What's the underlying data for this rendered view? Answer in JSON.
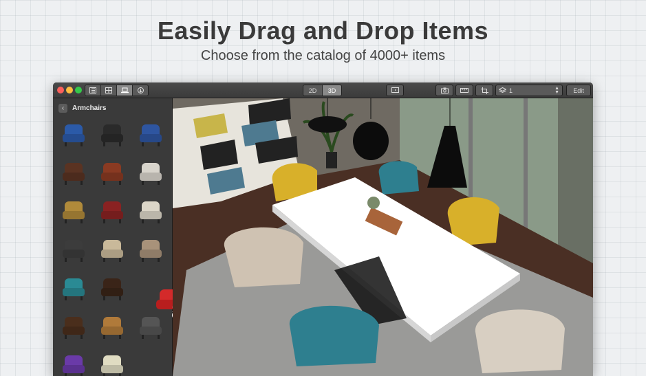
{
  "headline": "Easily Drag and Drop Items",
  "subline": "Choose from the catalog of 4000+ items",
  "toolbar": {
    "view_2d": "2D",
    "view_3d": "3D",
    "level_value": "1",
    "edit_label": "Edit"
  },
  "sidebar": {
    "title": "Armchairs",
    "items": [
      {
        "name": "armchair-blue",
        "color": "#2b5aa8"
      },
      {
        "name": "armchair-black",
        "color": "#2a2a2a"
      },
      {
        "name": "armchair-navy",
        "color": "#2e55a0"
      },
      {
        "name": "recliner-brown",
        "color": "#5a3322"
      },
      {
        "name": "armchair-rust",
        "color": "#8a3a22"
      },
      {
        "name": "armchair-white",
        "color": "#d8d4cc"
      },
      {
        "name": "armchair-mustard",
        "color": "#b08a3a"
      },
      {
        "name": "rocking-chair-red",
        "color": "#8a2222"
      },
      {
        "name": "armchair-cream",
        "color": "#dcd6c8"
      },
      {
        "name": "armchair-charcoal",
        "color": "#3c3c3c"
      },
      {
        "name": "armchair-beige",
        "color": "#c9b99a"
      },
      {
        "name": "armchair-taupe",
        "color": "#a8927a"
      },
      {
        "name": "armchair-teal",
        "color": "#2a8a94"
      },
      {
        "name": "armchair-dark",
        "color": "#3a2418"
      },
      {
        "name": "armchair-ochre",
        "color": "#a87838"
      },
      {
        "name": "armchair-walnut",
        "color": "#4a2e1c"
      },
      {
        "name": "lounge-chair-tan",
        "color": "#b07a3a"
      },
      {
        "name": "chair-wire",
        "color": "#555555"
      },
      {
        "name": "armchair-purple",
        "color": "#6a3aa8"
      },
      {
        "name": "armchair-ivory",
        "color": "#e0dcc2"
      }
    ],
    "dragging_item": {
      "name": "armchair-red",
      "color": "#d42a2a"
    }
  }
}
